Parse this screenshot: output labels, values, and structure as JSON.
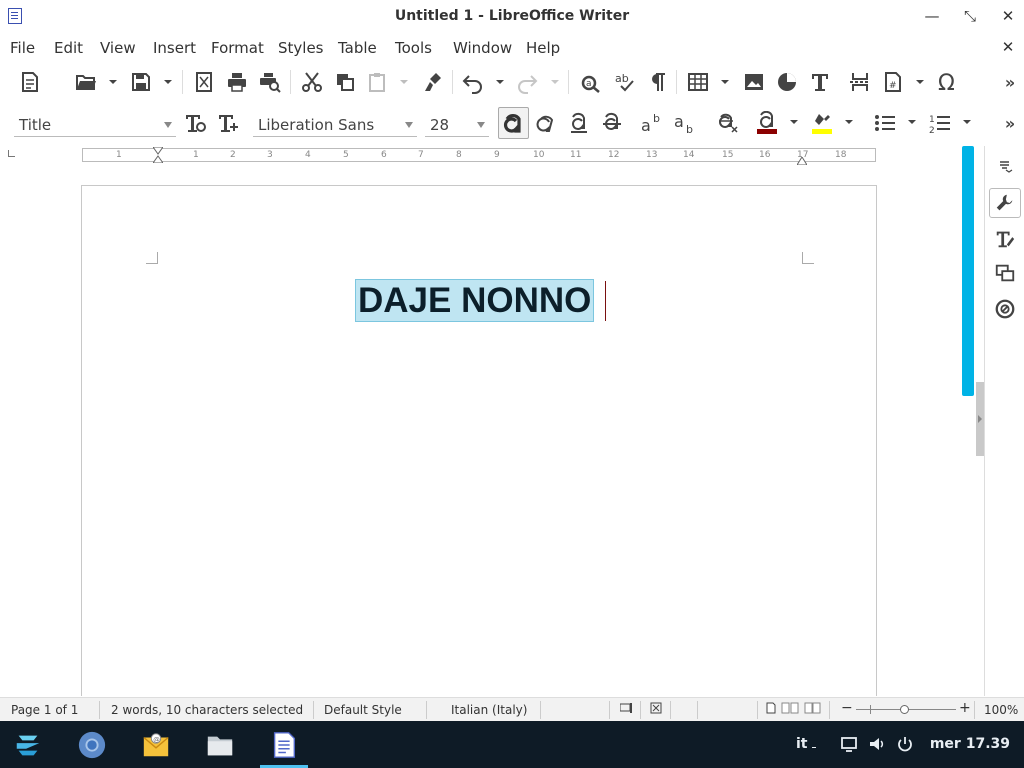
{
  "window": {
    "title": "Untitled 1 - LibreOffice Writer",
    "minimize_icon": "minimize-icon",
    "restore_icon": "restore-icon",
    "close_icon": "close-icon"
  },
  "menu": {
    "items": [
      "File",
      "Edit",
      "View",
      "Insert",
      "Format",
      "Styles",
      "Table",
      "Tools",
      "Window",
      "Help"
    ]
  },
  "formatting": {
    "paragraph_style": "Title",
    "font_name": "Liberation Sans",
    "font_size": "28"
  },
  "ruler": {
    "ticks": [
      "1",
      "1",
      "2",
      "3",
      "4",
      "5",
      "6",
      "7",
      "8",
      "9",
      "10",
      "11",
      "12",
      "13",
      "14",
      "15",
      "16",
      "17",
      "18"
    ]
  },
  "document": {
    "title_text": "DAJE NONNO"
  },
  "status": {
    "page": "Page 1 of 1",
    "word_count": "2 words, 10 characters selected",
    "page_style": "Default Style",
    "language": "Italian (Italy)",
    "zoom": "100%"
  },
  "taskbar": {
    "keyboard_layout": "it",
    "clock": "mer 17.39"
  },
  "colors": {
    "accent": "#00b3e6",
    "selection": "#bfe5f2",
    "font_color_swatch": "#8b0000",
    "highlight_swatch": "#ffff00",
    "taskbar_bg": "#0e1b26"
  }
}
